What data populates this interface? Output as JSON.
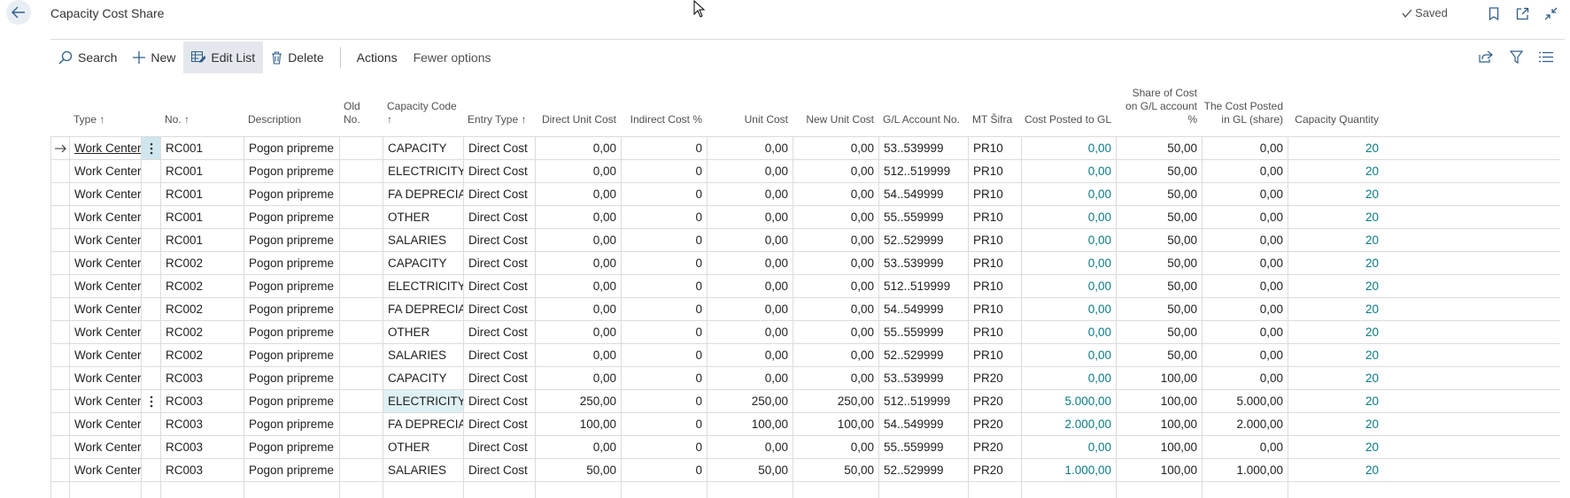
{
  "page": {
    "title": "Capacity Cost Share",
    "saved_label": "Saved"
  },
  "toolbar": {
    "search": "Search",
    "new": "New",
    "edit_list": "Edit List",
    "delete": "Delete",
    "actions": "Actions",
    "fewer_options": "Fewer options"
  },
  "columns": [
    {
      "key": "type",
      "label": "Type ↑",
      "align": "left"
    },
    {
      "key": "no",
      "label": "No. ↑",
      "align": "left"
    },
    {
      "key": "description",
      "label": "Description",
      "align": "left"
    },
    {
      "key": "old_no",
      "label": "Old No.",
      "align": "left"
    },
    {
      "key": "capacity_code",
      "label": "Capacity Code ↑",
      "align": "left"
    },
    {
      "key": "entry_type",
      "label": "Entry Type ↑",
      "align": "left"
    },
    {
      "key": "direct_unit_cost",
      "label": "Direct Unit Cost",
      "align": "right"
    },
    {
      "key": "indirect_cost_pct",
      "label": "Indirect Cost %",
      "align": "right"
    },
    {
      "key": "unit_cost",
      "label": "Unit Cost",
      "align": "right"
    },
    {
      "key": "new_unit_cost",
      "label": "New Unit Cost",
      "align": "right"
    },
    {
      "key": "gl_account_no",
      "label": "G/L Account No.",
      "align": "left"
    },
    {
      "key": "mt_sifra",
      "label": "MT Šifra",
      "align": "left"
    },
    {
      "key": "cost_posted_to_gl",
      "label": "Cost Posted to GL",
      "align": "right"
    },
    {
      "key": "share_of_cost",
      "label": "Share of Cost on G/L account %",
      "align": "right"
    },
    {
      "key": "cost_posted_share",
      "label": "The Cost Posted in GL (share)",
      "align": "right"
    },
    {
      "key": "capacity_quantity",
      "label": "Capacity Quantity",
      "align": "right"
    }
  ],
  "rows": [
    [
      "Work Center",
      "RC001",
      "Pogon pripreme",
      "",
      "CAPACITY",
      "Direct Cost",
      "0,00",
      "0",
      "0,00",
      "0,00",
      "53..539999",
      "PR10",
      "0,00",
      "50,00",
      "0,00",
      "20"
    ],
    [
      "Work Center",
      "RC001",
      "Pogon pripreme",
      "",
      "ELECTRICITY",
      "Direct Cost",
      "0,00",
      "0",
      "0,00",
      "0,00",
      "512..519999",
      "PR10",
      "0,00",
      "50,00",
      "0,00",
      "20"
    ],
    [
      "Work Center",
      "RC001",
      "Pogon pripreme",
      "",
      "FA DEPRECIAT...",
      "Direct Cost",
      "0,00",
      "0",
      "0,00",
      "0,00",
      "54..549999",
      "PR10",
      "0,00",
      "50,00",
      "0,00",
      "20"
    ],
    [
      "Work Center",
      "RC001",
      "Pogon pripreme",
      "",
      "OTHER",
      "Direct Cost",
      "0,00",
      "0",
      "0,00",
      "0,00",
      "55..559999",
      "PR10",
      "0,00",
      "50,00",
      "0,00",
      "20"
    ],
    [
      "Work Center",
      "RC001",
      "Pogon pripreme",
      "",
      "SALARIES",
      "Direct Cost",
      "0,00",
      "0",
      "0,00",
      "0,00",
      "52..529999",
      "PR10",
      "0,00",
      "50,00",
      "0,00",
      "20"
    ],
    [
      "Work Center",
      "RC002",
      "Pogon pripreme",
      "",
      "CAPACITY",
      "Direct Cost",
      "0,00",
      "0",
      "0,00",
      "0,00",
      "53..539999",
      "PR10",
      "0,00",
      "50,00",
      "0,00",
      "20"
    ],
    [
      "Work Center",
      "RC002",
      "Pogon pripreme",
      "",
      "ELECTRICITY",
      "Direct Cost",
      "0,00",
      "0",
      "0,00",
      "0,00",
      "512..519999",
      "PR10",
      "0,00",
      "50,00",
      "0,00",
      "20"
    ],
    [
      "Work Center",
      "RC002",
      "Pogon pripreme",
      "",
      "FA DEPRECIAT...",
      "Direct Cost",
      "0,00",
      "0",
      "0,00",
      "0,00",
      "54..549999",
      "PR10",
      "0,00",
      "50,00",
      "0,00",
      "20"
    ],
    [
      "Work Center",
      "RC002",
      "Pogon pripreme",
      "",
      "OTHER",
      "Direct Cost",
      "0,00",
      "0",
      "0,00",
      "0,00",
      "55..559999",
      "PR10",
      "0,00",
      "50,00",
      "0,00",
      "20"
    ],
    [
      "Work Center",
      "RC002",
      "Pogon pripreme",
      "",
      "SALARIES",
      "Direct Cost",
      "0,00",
      "0",
      "0,00",
      "0,00",
      "52..529999",
      "PR10",
      "0,00",
      "50,00",
      "0,00",
      "20"
    ],
    [
      "Work Center",
      "RC003",
      "Pogon pripreme",
      "",
      "CAPACITY",
      "Direct Cost",
      "0,00",
      "0",
      "0,00",
      "0,00",
      "53..539999",
      "PR20",
      "0,00",
      "100,00",
      "0,00",
      "20"
    ],
    [
      "Work Center",
      "RC003",
      "Pogon pripreme",
      "",
      "ELECTRICITY",
      "Direct Cost",
      "250,00",
      "0",
      "250,00",
      "250,00",
      "512..519999",
      "PR20",
      "5.000,00",
      "100,00",
      "5.000,00",
      "20"
    ],
    [
      "Work Center",
      "RC003",
      "Pogon pripreme",
      "",
      "FA DEPRECIAT...",
      "Direct Cost",
      "100,00",
      "0",
      "100,00",
      "100,00",
      "54..549999",
      "PR20",
      "2.000,00",
      "100,00",
      "2.000,00",
      "20"
    ],
    [
      "Work Center",
      "RC003",
      "Pogon pripreme",
      "",
      "OTHER",
      "Direct Cost",
      "0,00",
      "0",
      "0,00",
      "0,00",
      "55..559999",
      "PR20",
      "0,00",
      "100,00",
      "0,00",
      "20"
    ],
    [
      "Work Center",
      "RC003",
      "Pogon pripreme",
      "",
      "SALARIES",
      "Direct Cost",
      "50,00",
      "0",
      "50,00",
      "50,00",
      "52..529999",
      "PR20",
      "1.000,00",
      "100,00",
      "1.000,00",
      "20"
    ]
  ],
  "selection": {
    "current_row": 0,
    "focused_row": 11,
    "focused_column": "capacity_code"
  },
  "colors": {
    "link": "#0a7a86",
    "selected_cell": "#dff0f5",
    "grid_line": "#dcdcdc",
    "active_button": "#e4e8ee"
  },
  "icons": [
    "back-arrow-icon",
    "checkmark-icon",
    "bookmark-icon",
    "open-new-window-icon",
    "collapse-icon",
    "search-icon",
    "plus-icon",
    "edit-list-icon",
    "trash-icon",
    "share-icon",
    "filter-icon",
    "list-view-icon",
    "row-arrow-icon",
    "row-menu-icon"
  ]
}
